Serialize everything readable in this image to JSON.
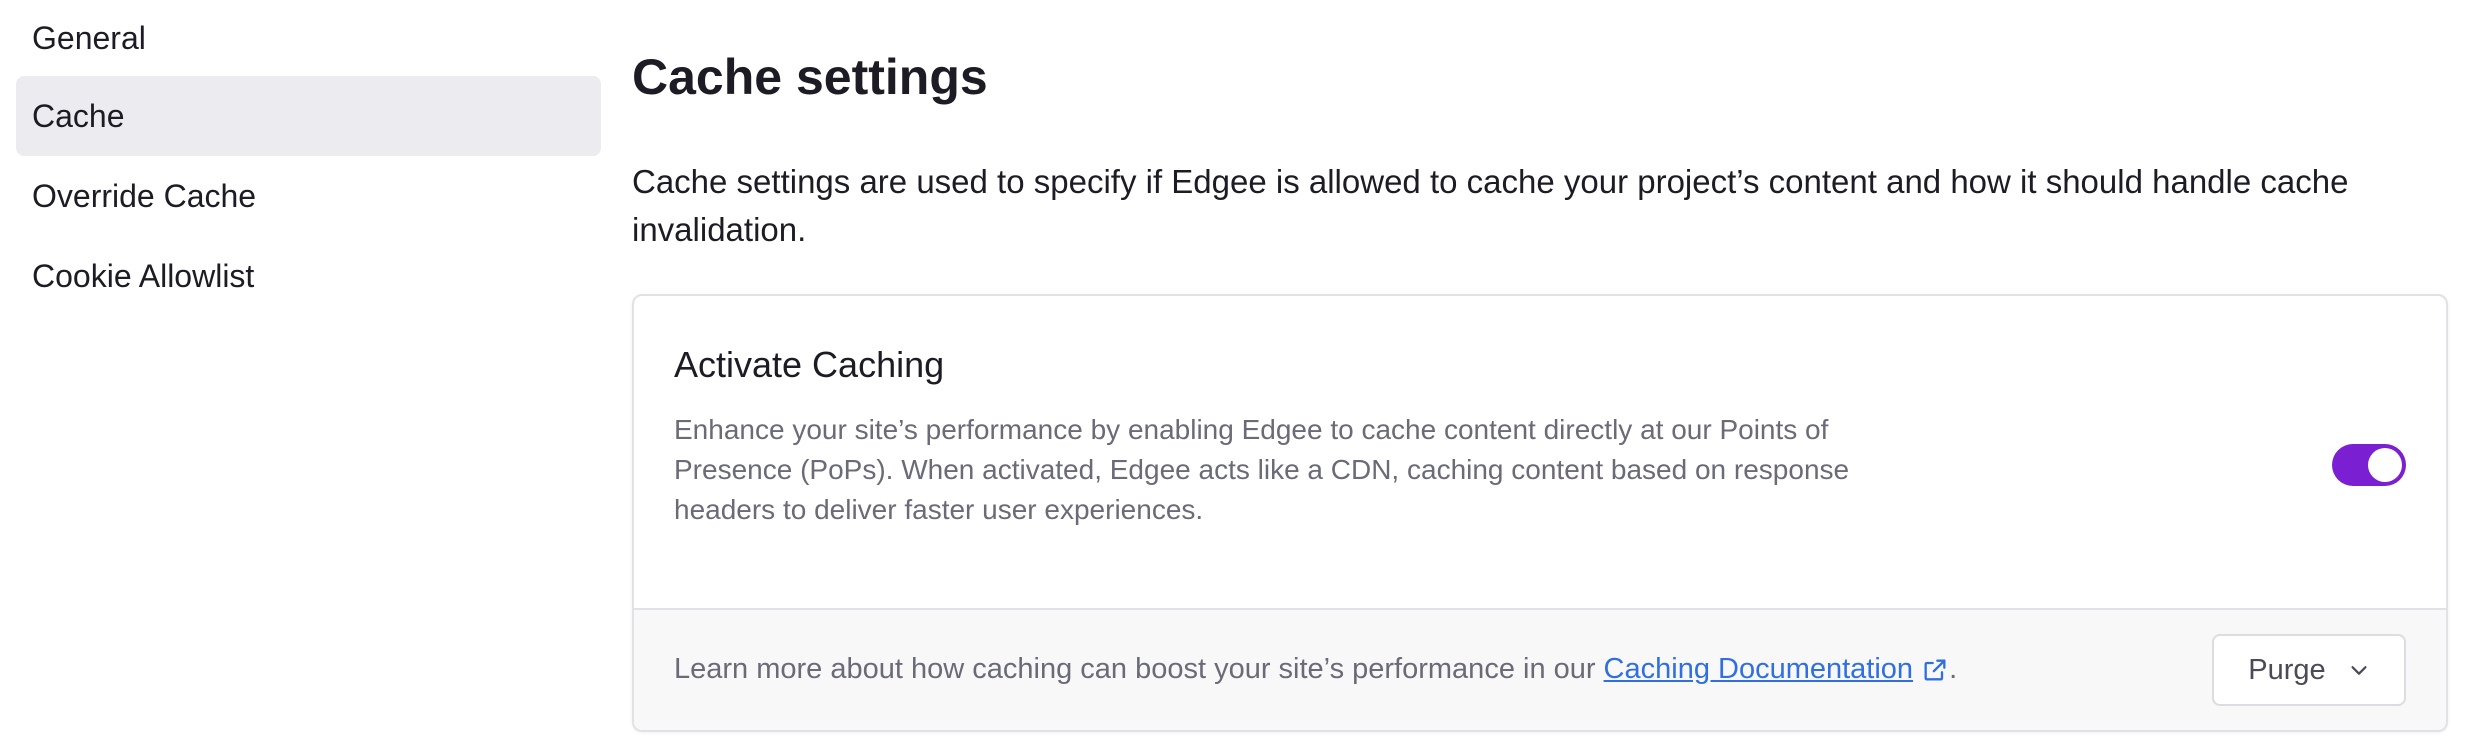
{
  "sidebar": {
    "items": [
      {
        "label": "General"
      },
      {
        "label": "Cache"
      },
      {
        "label": "Override Cache"
      },
      {
        "label": "Cookie Allowlist"
      }
    ],
    "active_index": 1
  },
  "main": {
    "title": "Cache settings",
    "description": "Cache settings are used to specify if Edgee is allowed to cache your project’s content and how it should handle cache invalidation."
  },
  "card": {
    "title": "Activate Caching",
    "description": "Enhance your site’s performance by enabling Edgee to cache content directly at our Points of Presence (PoPs). When activated, Edgee acts like a CDN, caching content based on response headers to deliver faster user experiences.",
    "toggle_on": true,
    "footer": {
      "text": "Learn more about how caching can boost your site’s performance in our",
      "link_label": "Caching Documentation",
      "suffix": "."
    },
    "purge_button": "Purge"
  },
  "colors": {
    "accent": "#7b1fd2",
    "link": "#2f6fe0",
    "active_bg": "#ececf0"
  },
  "icons": {
    "external_link": "external-link-icon",
    "purge_dropdown": "chevron-down-icon"
  }
}
